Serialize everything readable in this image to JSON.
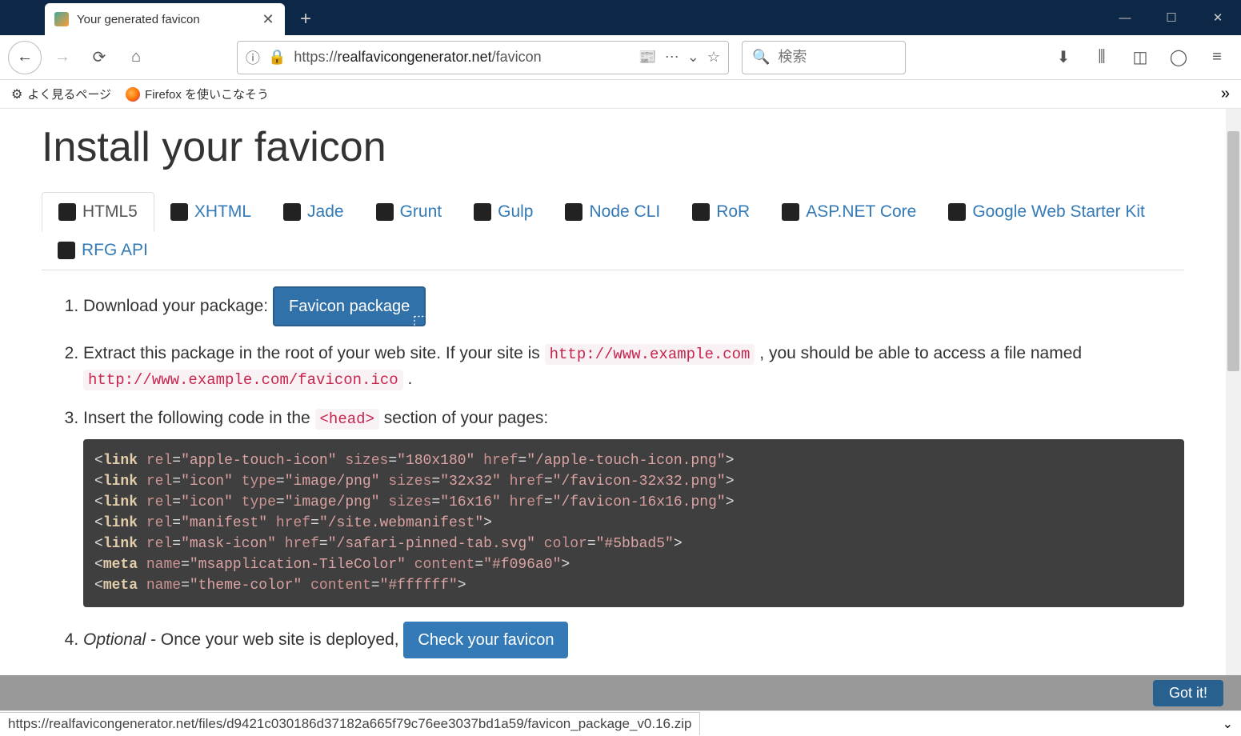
{
  "browser": {
    "tab_title": "Your generated favicon",
    "url_proto": "https://",
    "url_host": "realfavicongenerator.net",
    "url_path": "/favicon",
    "search_placeholder": "検索",
    "bookmarks": {
      "freq": "よく見るページ",
      "ff": "Firefox を使いこなそう"
    },
    "status_url": "https://realfavicongenerator.net/files/d9421c030186d37182a665f79c76ee3037bd1a59/favicon_package_v0.16.zip"
  },
  "page": {
    "heading": "Install your favicon",
    "tabs": [
      "HTML5",
      "XHTML",
      "Jade",
      "Grunt",
      "Gulp",
      "Node CLI",
      "RoR",
      "ASP.NET Core",
      "Google Web Starter Kit",
      "RFG API"
    ],
    "steps": {
      "s1_prefix": "Download your package: ",
      "s1_button": "Favicon package",
      "s2_a": "Extract this package in the root of your web site. If your site is ",
      "s2_code1": "http://www.example.com",
      "s2_b": ", you should be able to access a file named ",
      "s2_code2": "http://www.example.com/favicon.ico",
      "s2_c": ".",
      "s3_a": "Insert the following code in the ",
      "s3_code": "<head>",
      "s3_b": " section of your pages:",
      "s4_opt": "Optional",
      "s4_a": " - Once your web site is deployed, ",
      "s4_button": "Check your favicon"
    },
    "code_lines": [
      {
        "tag": "link",
        "attrs": [
          [
            "rel",
            "apple-touch-icon"
          ],
          [
            "sizes",
            "180x180"
          ],
          [
            "href",
            "/apple-touch-icon.png"
          ]
        ]
      },
      {
        "tag": "link",
        "attrs": [
          [
            "rel",
            "icon"
          ],
          [
            "type",
            "image/png"
          ],
          [
            "sizes",
            "32x32"
          ],
          [
            "href",
            "/favicon-32x32.png"
          ]
        ]
      },
      {
        "tag": "link",
        "attrs": [
          [
            "rel",
            "icon"
          ],
          [
            "type",
            "image/png"
          ],
          [
            "sizes",
            "16x16"
          ],
          [
            "href",
            "/favicon-16x16.png"
          ]
        ]
      },
      {
        "tag": "link",
        "attrs": [
          [
            "rel",
            "manifest"
          ],
          [
            "href",
            "/site.webmanifest"
          ]
        ]
      },
      {
        "tag": "link",
        "attrs": [
          [
            "rel",
            "mask-icon"
          ],
          [
            "href",
            "/safari-pinned-tab.svg"
          ],
          [
            "color",
            "#5bbad5"
          ]
        ]
      },
      {
        "tag": "meta",
        "attrs": [
          [
            "name",
            "msapplication-TileColor"
          ],
          [
            "content",
            "#f096a0"
          ]
        ]
      },
      {
        "tag": "meta",
        "attrs": [
          [
            "name",
            "theme-color"
          ],
          [
            "content",
            "#ffffff"
          ]
        ]
      }
    ],
    "gotit": "Got it!"
  }
}
